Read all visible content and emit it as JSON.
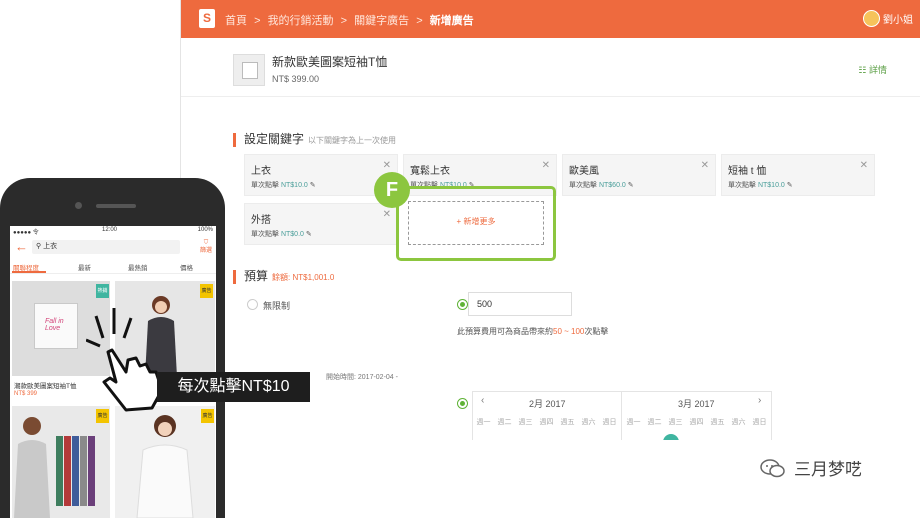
{
  "desktop": {
    "breadcrumbs": [
      "首頁 ",
      "我的行銷活動 ",
      "關鍵字廣告 "
    ],
    "breadcrumb_seps": [
      ">",
      ">",
      ">"
    ],
    "breadcrumb_current": "新增廣告",
    "user": "劉小姐",
    "product": {
      "name": "新款歐美圖案短袖T恤",
      "price": "NT$ 399.00",
      "detail_link": "詳情"
    },
    "keywords_section": {
      "title": "設定關鍵字",
      "subtitle": "以下關鍵字為上一次使用"
    },
    "keywords": [
      {
        "name": "上衣",
        "bid_label": "單次點擊",
        "bid": "NT$10.0"
      },
      {
        "name": "寬鬆上衣",
        "bid_label": "單次點擊",
        "bid": "NT$10.0"
      },
      {
        "name": "歐美風",
        "bid_label": "單次點擊",
        "bid": "NT$60.0"
      },
      {
        "name": "短袖 t 恤",
        "bid_label": "單次點擊",
        "bid": "NT$10.0"
      },
      {
        "name": "外搭",
        "bid_label": "單次點擊",
        "bid": "NT$0.0"
      }
    ],
    "add_more": "+ 新增更多",
    "step_badge": "F",
    "budget_section": {
      "title": "預算",
      "note": "餘額: NT$1,001.0"
    },
    "budget_unlimited": "無限制",
    "budget_value": "500",
    "budget_hint": {
      "prefix": "此預算費用可為商品帶來約",
      "range": "50 ~ 100",
      "suffix": "次點擊"
    },
    "schedule_hint": "開始時間: 2017-02-04 -",
    "calendar": {
      "month1": "2月 2017",
      "month2": "3月 2017",
      "prev": "‹",
      "next": "›",
      "weekdays1": [
        "週一",
        "週二",
        "週三",
        "週四",
        "週五",
        "週六",
        "週日"
      ],
      "weekdays2": [
        "週一",
        "週二",
        "週三",
        "週四",
        "週五",
        "週六",
        "週日"
      ]
    }
  },
  "mobile": {
    "status": {
      "carrier": "●●●●● 令",
      "time": "12:00",
      "battery": "100%"
    },
    "search_query": "上衣",
    "filter": "篩選",
    "tabs": [
      "關聯程度",
      "最新",
      "最熱銷",
      "價格"
    ],
    "product1": {
      "title": "潮款歐美圖案短袖T恤",
      "price": "NT$ 399",
      "tee_text": "Fall in Love"
    },
    "tag_hot": "熱銷",
    "tag_ad": "廣告"
  },
  "overlay": {
    "cpc_text": "每次點擊NT$10"
  },
  "watermark": "三月梦呓",
  "colors": {
    "brand": "#ee6a3e",
    "highlight": "#8cc63f",
    "link": "#4a9e9a"
  }
}
